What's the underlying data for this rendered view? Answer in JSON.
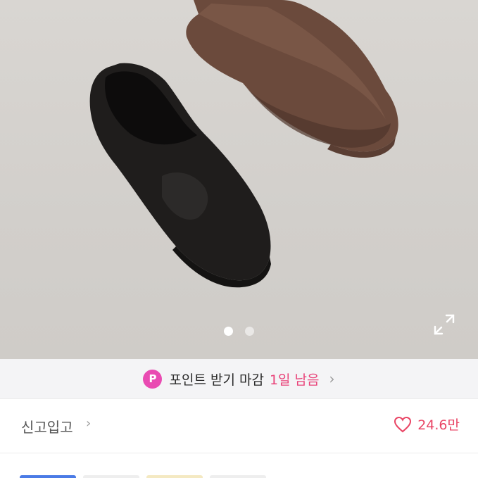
{
  "point_banner": {
    "badge": "P",
    "text": "포인트 받기 마감",
    "days_left": "1일 남음",
    "chevron": "chevron-right-icon"
  },
  "carousel": {
    "total": 2,
    "active": 1
  },
  "product": {
    "condition": "신고입고",
    "likes": "24.6만"
  },
  "colors": {
    "badge": "#e94bb2",
    "accent": "#e9447a",
    "heart": "#e94464"
  },
  "tags": [
    "#4b7be6",
    "#eeeeee",
    "#f4e9c2",
    "#eeeeee"
  ]
}
